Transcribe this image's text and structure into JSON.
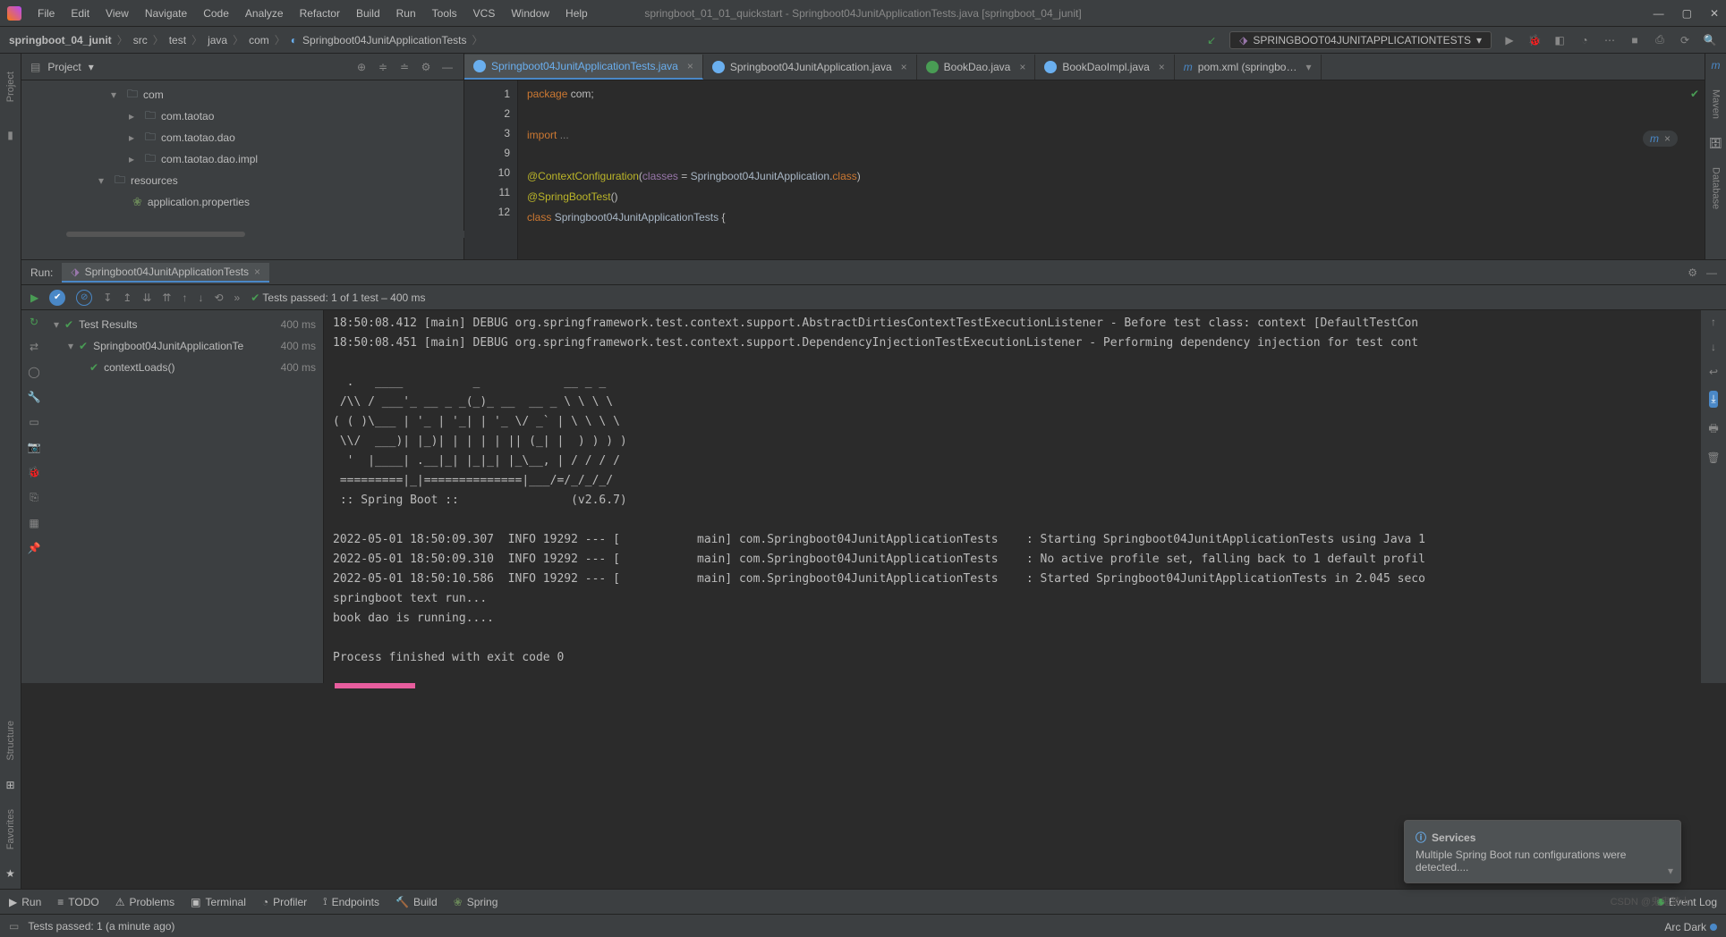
{
  "window": {
    "title": "springboot_01_01_quickstart - Springboot04JunitApplicationTests.java [springboot_04_junit]"
  },
  "menu": [
    "File",
    "Edit",
    "View",
    "Navigate",
    "Code",
    "Analyze",
    "Refactor",
    "Build",
    "Run",
    "Tools",
    "VCS",
    "Window",
    "Help"
  ],
  "breadcrumbs": [
    "springboot_04_junit",
    "src",
    "test",
    "java",
    "com",
    "Springboot04JunitApplicationTests"
  ],
  "runConfig": "SPRINGBOOT04JUNITAPPLICATIONTESTS",
  "project": {
    "header": "Project",
    "nodes": [
      {
        "depth": 0,
        "arrow": "▾",
        "icon": "folder",
        "label": "com"
      },
      {
        "depth": 1,
        "arrow": "▸",
        "icon": "folder",
        "label": "com.taotao"
      },
      {
        "depth": 1,
        "arrow": "▸",
        "icon": "folder",
        "label": "com.taotao.dao"
      },
      {
        "depth": 1,
        "arrow": "▸",
        "icon": "folder",
        "label": "com.taotao.dao.impl"
      },
      {
        "depth": -1,
        "arrow": "▾",
        "icon": "res",
        "label": "resources"
      },
      {
        "depth": 2,
        "arrow": "",
        "icon": "leaf",
        "label": "application.properties"
      }
    ]
  },
  "tabs": [
    {
      "icon": "#6aafef",
      "label": "Springboot04JunitApplicationTests.java",
      "active": true,
      "close": true
    },
    {
      "icon": "#6aafef",
      "label": "Springboot04JunitApplication.java",
      "active": false,
      "close": true
    },
    {
      "icon": "#499c54",
      "label": "BookDao.java",
      "active": false,
      "close": true
    },
    {
      "icon": "#6aafef",
      "label": "BookDaoImpl.java",
      "active": false,
      "close": true
    },
    {
      "icon": "#4a88c7",
      "label": "pom.xml (springbo…",
      "active": false,
      "close": false,
      "more": true
    }
  ],
  "gutter": [
    "1",
    "2",
    "3",
    "9",
    "10",
    "11",
    "12"
  ],
  "code": {
    "l1a": "package ",
    "l1b": "com",
    "l1c": ";",
    "l3a": "import ",
    "l3b": "...",
    "l10a": "@ContextConfiguration",
    "l10b": "(",
    "l10c": "classes ",
    "l10d": "= ",
    "l10e": "Springboot04JunitApplication",
    "l10f": ".",
    "l10g": "class",
    "l10h": ")",
    "l11a": "@SpringBootTest",
    "l11b": "()",
    "l12a": "class ",
    "l12b": "Springboot04JunitApplicationTests ",
    "l12c": "{"
  },
  "run": {
    "label": "Run:",
    "tab": "Springboot04JunitApplicationTests",
    "testsPassed": "Tests passed: 1 of 1 test – 400 ms",
    "tree": [
      {
        "depth": 0,
        "label": "Test Results",
        "time": "400 ms"
      },
      {
        "depth": 1,
        "label": "Springboot04JunitApplicationTe",
        "time": "400 ms"
      },
      {
        "depth": 2,
        "label": "contextLoads()",
        "time": "400 ms"
      }
    ],
    "console": "18:50:08.412 [main] DEBUG org.springframework.test.context.support.AbstractDirtiesContextTestExecutionListener - Before test class: context [DefaultTestCon\n18:50:08.451 [main] DEBUG org.springframework.test.context.support.DependencyInjectionTestExecutionListener - Performing dependency injection for test cont\n\n  .   ____          _            __ _ _\n /\\\\ / ___'_ __ _ _(_)_ __  __ _ \\ \\ \\ \\\n( ( )\\___ | '_ | '_| | '_ \\/ _` | \\ \\ \\ \\\n \\\\/  ___)| |_)| | | | | || (_| |  ) ) ) )\n  '  |____| .__|_| |_|_| |_\\__, | / / / /\n =========|_|==============|___/=/_/_/_/\n :: Spring Boot ::                (v2.6.7)\n\n2022-05-01 18:50:09.307  INFO 19292 --- [           main] com.Springboot04JunitApplicationTests    : Starting Springboot04JunitApplicationTests using Java 1\n2022-05-01 18:50:09.310  INFO 19292 --- [           main] com.Springboot04JunitApplicationTests    : No active profile set, falling back to 1 default profil\n2022-05-01 18:50:10.586  INFO 19292 --- [           main] com.Springboot04JunitApplicationTests    : Started Springboot04JunitApplicationTests in 2.045 seco\nspringboot text run...\nbook dao is running....\n\nProcess finished with exit code 0\n"
  },
  "bottom": {
    "tabs": [
      {
        "icon": "▶",
        "label": "Run"
      },
      {
        "icon": "≡",
        "label": "TODO"
      },
      {
        "icon": "⚠",
        "label": "Problems"
      },
      {
        "icon": "▣",
        "label": "Terminal"
      },
      {
        "icon": "◔",
        "label": "Profiler"
      },
      {
        "icon": "⟟",
        "label": "Endpoints"
      },
      {
        "icon": "🔨",
        "label": "Build"
      },
      {
        "icon": "❀",
        "label": "Spring"
      }
    ],
    "eventLog": "Event Log"
  },
  "status": {
    "text": "Tests passed: 1 (a minute ago)",
    "arc": "Arc Dark"
  },
  "notif": {
    "title": "Services",
    "body": "Multiple Spring Boot run configurations were detected...."
  },
  "leftTabs": [
    "Project"
  ],
  "leftTabs2": [
    "Structure",
    "Favorites"
  ],
  "rightTabs": [
    "Maven",
    "Database"
  ],
  "watermark": "CSDN @鬼鬼骑士"
}
